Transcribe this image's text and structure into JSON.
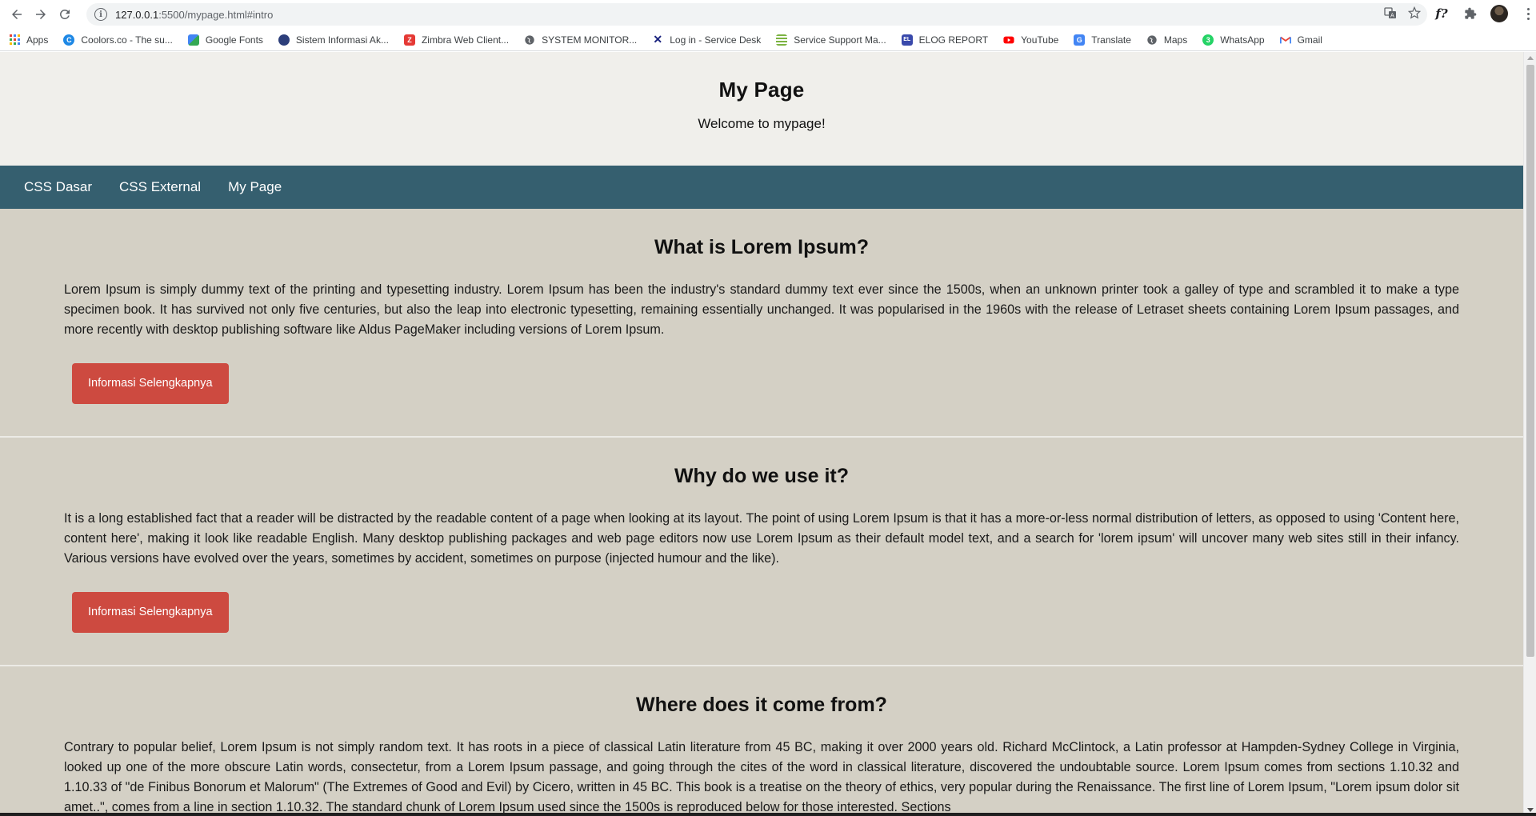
{
  "browser": {
    "url_host": "127.0.0.1",
    "url_path": ":5500/mypage.html#intro",
    "bookmarks": [
      {
        "label": "Apps",
        "icon": "apps-grid-icon"
      },
      {
        "label": "Coolors.co - The su...",
        "icon": "coolors-icon",
        "color": "#1e88e5"
      },
      {
        "label": "Google Fonts",
        "icon": "google-fonts-icon",
        "color": "#4285f4"
      },
      {
        "label": "Sistem Informasi Ak...",
        "icon": "university-icon",
        "color": "#2c3e7a"
      },
      {
        "label": "Zimbra Web Client...",
        "icon": "zimbra-icon",
        "color": "#e53935"
      },
      {
        "label": "SYSTEM MONITOR...",
        "icon": "globe-icon",
        "color": "#5f6368"
      },
      {
        "label": "Log in - Service Desk",
        "icon": "service-desk-icon",
        "color": "#1a237e"
      },
      {
        "label": "Service Support Ma...",
        "icon": "service-support-icon",
        "color": "#7cb342"
      },
      {
        "label": "ELOG REPORT",
        "icon": "elog-icon",
        "color": "#3949ab"
      },
      {
        "label": "YouTube",
        "icon": "youtube-icon",
        "color": "#ff0000"
      },
      {
        "label": "Translate",
        "icon": "translate-icon",
        "color": "#4285f4"
      },
      {
        "label": "Maps",
        "icon": "globe-icon",
        "color": "#5f6368"
      },
      {
        "label": "WhatsApp",
        "icon": "whatsapp-icon",
        "color": "#25d366"
      },
      {
        "label": "Gmail",
        "icon": "gmail-icon",
        "color": "#ea4335"
      }
    ]
  },
  "page": {
    "header": {
      "title": "My Page",
      "subtitle": "Welcome to mypage!"
    },
    "nav": [
      {
        "label": "CSS Dasar"
      },
      {
        "label": "CSS External"
      },
      {
        "label": "My Page"
      }
    ],
    "sections": [
      {
        "title": "What is Lorem Ipsum?",
        "body": "Lorem Ipsum is simply dummy text of the printing and typesetting industry. Lorem Ipsum has been the industry's standard dummy text ever since the 1500s, when an unknown printer took a galley of type and scrambled it to make a type specimen book. It has survived not only five centuries, but also the leap into electronic typesetting, remaining essentially unchanged. It was popularised in the 1960s with the release of Letraset sheets containing Lorem Ipsum passages, and more recently with desktop publishing software like Aldus PageMaker including versions of Lorem Ipsum.",
        "button": "Informasi Selengkapnya"
      },
      {
        "title": "Why do we use it?",
        "body": "It is a long established fact that a reader will be distracted by the readable content of a page when looking at its layout. The point of using Lorem Ipsum is that it has a more-or-less normal distribution of letters, as opposed to using 'Content here, content here', making it look like readable English. Many desktop publishing packages and web page editors now use Lorem Ipsum as their default model text, and a search for 'lorem ipsum' will uncover many web sites still in their infancy. Various versions have evolved over the years, sometimes by accident, sometimes on purpose (injected humour and the like).",
        "button": "Informasi Selengkapnya"
      },
      {
        "title": "Where does it come from?",
        "body": "Contrary to popular belief, Lorem Ipsum is not simply random text. It has roots in a piece of classical Latin literature from 45 BC, making it over 2000 years old. Richard McClintock, a Latin professor at Hampden-Sydney College in Virginia, looked up one of the more obscure Latin words, consectetur, from a Lorem Ipsum passage, and going through the cites of the word in classical literature, discovered the undoubtable source. Lorem Ipsum comes from sections 1.10.32 and 1.10.33 of \"de Finibus Bonorum et Malorum\" (The Extremes of Good and Evil) by Cicero, written in 45 BC. This book is a treatise on the theory of ethics, very popular during the Renaissance. The first line of Lorem Ipsum, \"Lorem ipsum dolor sit amet..\", comes from a line in section 1.10.32. The standard chunk of Lorem Ipsum used since the 1500s is reproduced below for those interested. Sections"
      }
    ]
  },
  "colors": {
    "header_bg": "#f0efeb",
    "nav_bg": "#355f6f",
    "section_bg": "#d4d0c5",
    "button_bg": "#cd4a40"
  }
}
